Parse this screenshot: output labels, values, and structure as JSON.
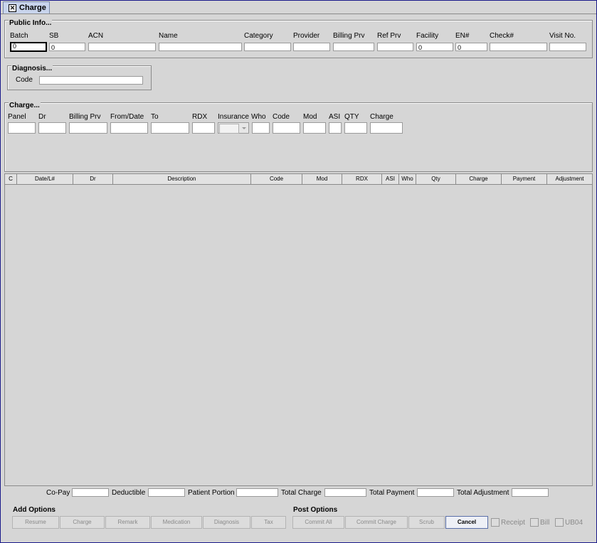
{
  "tab": {
    "title": "Charge"
  },
  "public_info": {
    "legend": "Public Info...",
    "labels": {
      "batch": "Batch",
      "sb": "SB",
      "acn": "ACN",
      "name": "Name",
      "category": "Category",
      "provider": "Provider",
      "billing_prv": "Billing Prv",
      "ref_prv": "Ref Prv",
      "facility": "Facility",
      "en": "EN#",
      "check": "Check#",
      "visit_no": "Visit No."
    },
    "values": {
      "batch": "0",
      "sb": "0",
      "facility": "0",
      "en": "0"
    }
  },
  "diagnosis": {
    "legend": "Diagnosis...",
    "code_label": "Code",
    "code_value": ""
  },
  "charge": {
    "legend": "Charge...",
    "labels": {
      "panel": "Panel",
      "dr": "Dr",
      "billing_prv": "Billing Prv",
      "from_date": "From/Date",
      "to": "To",
      "rdx": "RDX",
      "insurance": "Insurance",
      "who": "Who",
      "code": "Code",
      "mod": "Mod",
      "asi": "ASI",
      "qty": "QTY",
      "charge": "Charge"
    }
  },
  "grid": {
    "columns": [
      "C",
      "Date/L#",
      "Dr",
      "Description",
      "Code",
      "Mod",
      "RDX",
      "ASI",
      "Who",
      "Qty",
      "Charge",
      "Payment",
      "Adjustment"
    ]
  },
  "totals": {
    "copay": "Co-Pay",
    "deductible": "Deductible",
    "patient_portion": "Patient Portion",
    "total_charge": "Total Charge",
    "total_payment": "Total Payment",
    "total_adjustment": "Total Adjustment"
  },
  "add_options": {
    "title": "Add Options",
    "buttons": [
      "Resume",
      "Charge",
      "Remark",
      "Medication",
      "Diagnosis",
      "Tax"
    ]
  },
  "post_options": {
    "title": "Post Options",
    "commit_all": "Commit All",
    "commit_charge": "Commit Charge",
    "scrub": "Scrub",
    "cancel": "Cancel",
    "receipt": "Receipt",
    "bill": "Bill",
    "ub04": "UB04"
  }
}
